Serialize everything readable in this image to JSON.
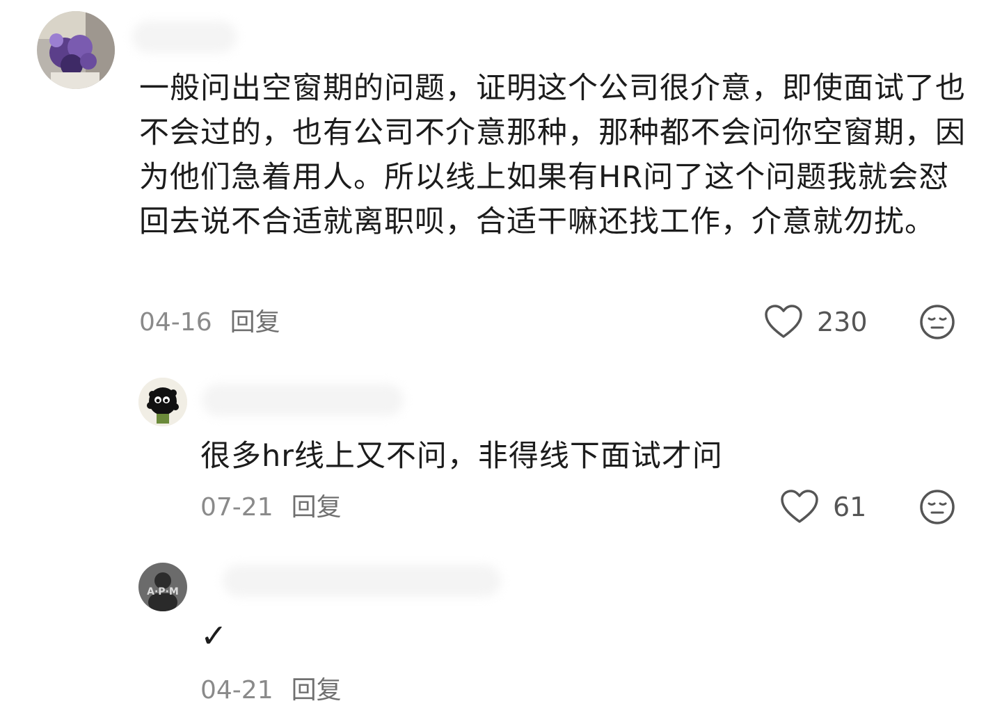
{
  "comments": [
    {
      "text": "一般问出空窗期的问题，证明这个公司很介意，即使面试了也不会过的，也有公司不介意那种，那种都不会问你空窗期，因为他们急着用人。所以线上如果有HR问了这个问题我就会怼回去说不合适就离职呗，合适干嘛还找工作，介意就勿扰。",
      "date": "04-16",
      "reply_label": "回复",
      "likes": "230",
      "avatar_icon": "purple-flowers-avatar",
      "like_icon": "heart-icon",
      "dislike_icon": "neutral-face-icon"
    },
    {
      "text": "很多hr线上又不问，非得线下面试才问",
      "date": "07-21",
      "reply_label": "回复",
      "likes": "61",
      "avatar_icon": "soot-sprite-avatar",
      "like_icon": "heart-icon",
      "dislike_icon": "neutral-face-icon"
    },
    {
      "text": "✓",
      "date": "04-21",
      "reply_label": "回复",
      "avatar_icon": "apm-person-avatar",
      "avatar_text": "A·P·M"
    }
  ],
  "colors": {
    "text": "#1c1c1c",
    "meta": "#8a8a8a",
    "icon": "#555555"
  }
}
